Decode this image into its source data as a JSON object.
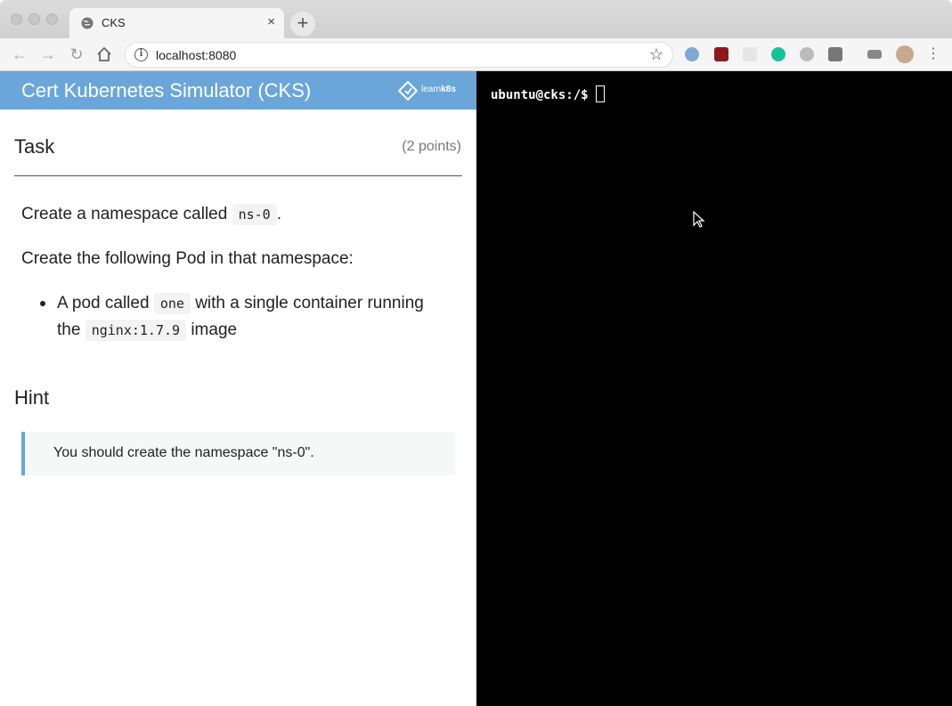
{
  "browser": {
    "tab_title": "CKS",
    "tab_close": "×",
    "new_tab": "+",
    "url": "localhost:8080",
    "info_icon_label": "i",
    "bookmark_icon": "☆"
  },
  "header": {
    "title": "Cert Kubernetes Simulator (CKS)",
    "logo_text_plain": "learn",
    "logo_text_bold": "k8s",
    "accent_color": "#6aa6d9"
  },
  "task": {
    "heading": "Task",
    "points": "(2 points)",
    "line1_before": "Create a namespace called",
    "line1_code": "ns-0",
    "line1_after": ".",
    "line2": "Create the following Pod in that namespace:",
    "item_before": "A pod called",
    "item_code1": "one",
    "item_middle": "with a single container running",
    "item_the": "the",
    "item_code2": "nginx:1.7.9",
    "item_after": "image"
  },
  "hint": {
    "heading": "Hint",
    "text": "You should create the namespace \"ns-0\"."
  },
  "terminal": {
    "prompt": "ubuntu@cks:/$"
  }
}
